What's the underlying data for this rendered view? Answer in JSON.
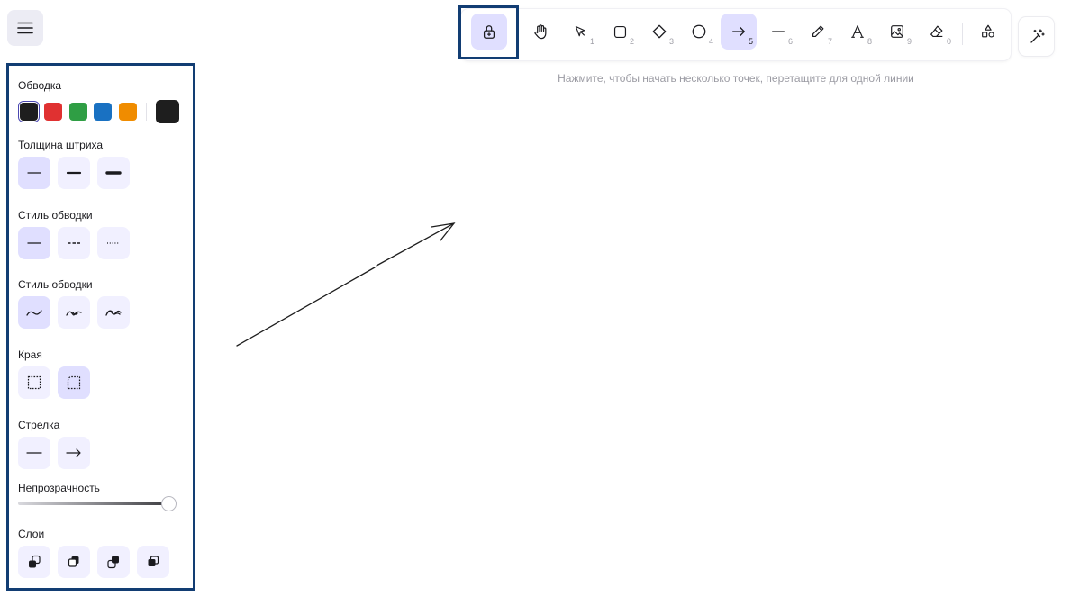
{
  "menu": {
    "icon": "hamburger-icon"
  },
  "toolbar": {
    "tools": [
      {
        "name": "lock",
        "icon": "lock-icon",
        "key": "",
        "active": true
      },
      {
        "name": "hand",
        "icon": "hand-icon",
        "key": "",
        "active": false
      },
      {
        "name": "selection",
        "icon": "pointer-icon",
        "key": "1",
        "active": false
      },
      {
        "name": "rectangle",
        "icon": "square-icon",
        "key": "2",
        "active": false
      },
      {
        "name": "diamond",
        "icon": "diamond-icon",
        "key": "3",
        "active": false
      },
      {
        "name": "ellipse",
        "icon": "circle-icon",
        "key": "4",
        "active": false
      },
      {
        "name": "arrow",
        "icon": "arrow-right-icon",
        "key": "5",
        "active": true
      },
      {
        "name": "line",
        "icon": "line-icon",
        "key": "6",
        "active": false
      },
      {
        "name": "draw",
        "icon": "pencil-icon",
        "key": "7",
        "active": false
      },
      {
        "name": "text",
        "icon": "text-icon",
        "key": "8",
        "active": false
      },
      {
        "name": "image",
        "icon": "image-icon",
        "key": "9",
        "active": false
      },
      {
        "name": "eraser",
        "icon": "eraser-icon",
        "key": "0",
        "active": false
      },
      {
        "name": "extra-tools",
        "icon": "shapes-icon",
        "key": "",
        "active": false
      }
    ],
    "hint": "Нажмите, чтобы начать несколько точек, перетащите для одной линии"
  },
  "magic": {
    "icon": "magic-wand-icon"
  },
  "panel": {
    "stroke_label": "Обводка",
    "stroke_colors": [
      "#1e1e1e",
      "#e03131",
      "#2f9e44",
      "#1971c2",
      "#f08c00"
    ],
    "stroke_current": "#1e1e1e",
    "stroke_width_label": "Толщина штриха",
    "stroke_style_label": "Стиль обводки",
    "sloppiness_label": "Стиль обводки",
    "edges_label": "Края",
    "arrowheads_label": "Стрелка",
    "opacity_label": "Непрозрачность",
    "opacity_value": 100,
    "layers_label": "Слои"
  }
}
